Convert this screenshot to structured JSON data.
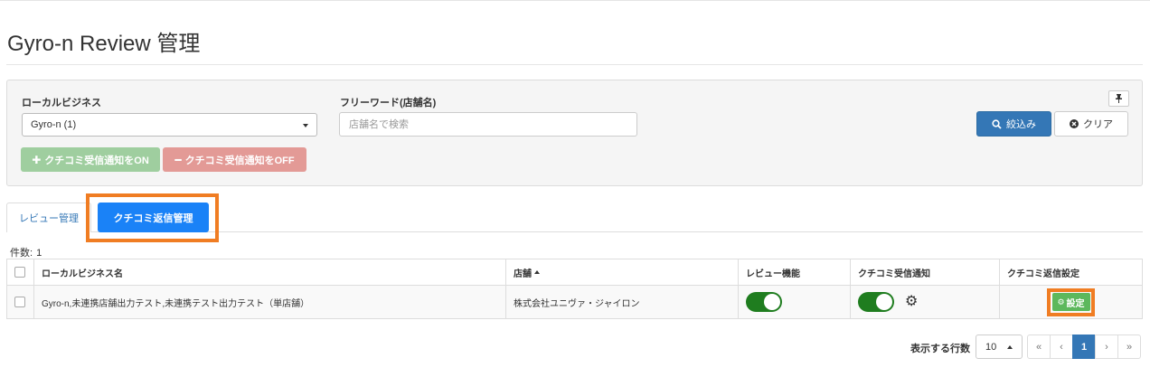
{
  "page": {
    "title": "Gyro-n Review 管理"
  },
  "filters": {
    "local_business_label": "ローカルビジネス",
    "local_business_value": "Gyro-n (1)",
    "freeword_label": "フリーワード(店舗名)",
    "freeword_placeholder": "店舗名で検索",
    "freeword_value": "",
    "notify_on_label": "クチコミ受信通知をON",
    "notify_off_label": "クチコミ受信通知をOFF",
    "search_label": "絞込み",
    "clear_label": "クリア"
  },
  "tabs": [
    {
      "label": "レビュー管理",
      "active": false
    },
    {
      "label": "クチコミ返信管理",
      "active": true
    }
  ],
  "count": {
    "label": "件数:",
    "value": "1"
  },
  "table": {
    "headers": [
      "ローカルビジネス名",
      "店舗",
      "レビュー機能",
      "クチコミ受信通知",
      "クチコミ返信設定"
    ],
    "sort_column": "店舗",
    "sort_direction": "asc",
    "rows": [
      {
        "business_name": "Gyro-n,未連携店舗出力テスト,未連携テスト出力テスト（単店舗）",
        "store": "株式会社ユニヴァ・ジャイロン",
        "review_enabled": true,
        "notification_enabled": true,
        "reply_settings_label": "設定"
      }
    ]
  },
  "pagination": {
    "rows_label": "表示する行数",
    "rows_value": "10",
    "first": "«",
    "prev": "‹",
    "current": "1",
    "next": "›",
    "last": "»"
  },
  "colors": {
    "primary": "#3477b6",
    "active_tab": "#1a82f7",
    "highlight": "#f07d23",
    "toggle_on": "#1f7d1f",
    "success": "#5cb85c"
  },
  "icons": [
    "pin-icon",
    "search-icon",
    "clear-icon",
    "plus-icon",
    "minus-icon",
    "gear-icon",
    "sort-up-icon",
    "caret-down-icon",
    "caret-up-icon"
  ]
}
